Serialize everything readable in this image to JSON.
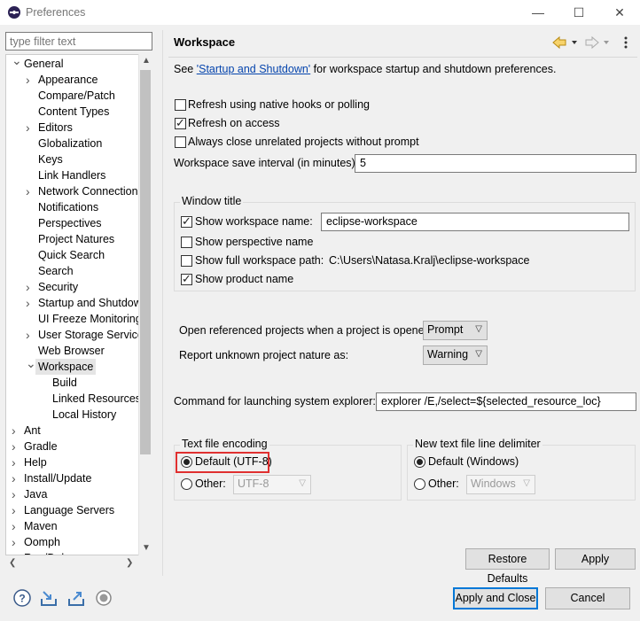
{
  "window": {
    "title": "Preferences",
    "controls": [
      "—",
      "☐",
      "✕"
    ]
  },
  "filter": {
    "placeholder": "type filter text"
  },
  "tree": [
    {
      "label": "General",
      "level": 0,
      "expander": "open"
    },
    {
      "label": "Appearance",
      "level": 1,
      "expander": "closed"
    },
    {
      "label": "Compare/Patch",
      "level": 1,
      "expander": ""
    },
    {
      "label": "Content Types",
      "level": 1,
      "expander": ""
    },
    {
      "label": "Editors",
      "level": 1,
      "expander": "closed"
    },
    {
      "label": "Globalization",
      "level": 1,
      "expander": ""
    },
    {
      "label": "Keys",
      "level": 1,
      "expander": ""
    },
    {
      "label": "Link Handlers",
      "level": 1,
      "expander": ""
    },
    {
      "label": "Network Connections",
      "level": 1,
      "expander": "closed"
    },
    {
      "label": "Notifications",
      "level": 1,
      "expander": ""
    },
    {
      "label": "Perspectives",
      "level": 1,
      "expander": ""
    },
    {
      "label": "Project Natures",
      "level": 1,
      "expander": ""
    },
    {
      "label": "Quick Search",
      "level": 1,
      "expander": ""
    },
    {
      "label": "Search",
      "level": 1,
      "expander": ""
    },
    {
      "label": "Security",
      "level": 1,
      "expander": "closed"
    },
    {
      "label": "Startup and Shutdown",
      "level": 1,
      "expander": "closed"
    },
    {
      "label": "UI Freeze Monitoring",
      "level": 1,
      "expander": ""
    },
    {
      "label": "User Storage Service",
      "level": 1,
      "expander": "closed"
    },
    {
      "label": "Web Browser",
      "level": 1,
      "expander": ""
    },
    {
      "label": "Workspace",
      "level": 1,
      "expander": "open",
      "selected": true
    },
    {
      "label": "Build",
      "level": 2,
      "expander": ""
    },
    {
      "label": "Linked Resources",
      "level": 2,
      "expander": ""
    },
    {
      "label": "Local History",
      "level": 2,
      "expander": ""
    },
    {
      "label": "Ant",
      "level": 0,
      "expander": "closed"
    },
    {
      "label": "Gradle",
      "level": 0,
      "expander": "closed"
    },
    {
      "label": "Help",
      "level": 0,
      "expander": "closed"
    },
    {
      "label": "Install/Update",
      "level": 0,
      "expander": "closed"
    },
    {
      "label": "Java",
      "level": 0,
      "expander": "closed"
    },
    {
      "label": "Language Servers",
      "level": 0,
      "expander": "closed"
    },
    {
      "label": "Maven",
      "level": 0,
      "expander": "closed"
    },
    {
      "label": "Oomph",
      "level": 0,
      "expander": "closed"
    },
    {
      "label": "Run/Debug",
      "level": 0,
      "expander": "closed"
    }
  ],
  "page": {
    "title": "Workspace",
    "intro_prefix": "See ",
    "intro_link": "'Startup and Shutdown'",
    "intro_suffix": " for workspace startup and shutdown preferences.",
    "options": [
      {
        "label": "Refresh using native hooks or polling",
        "checked": false
      },
      {
        "label": "Refresh on access",
        "checked": true
      },
      {
        "label": "Always close unrelated projects without prompt",
        "checked": false
      }
    ],
    "save_interval_label": "Workspace save interval (in minutes):",
    "save_interval_value": "5",
    "window_title": {
      "group_label": "Window title",
      "show_workspace_name_label": "Show workspace name:",
      "show_workspace_name_checked": true,
      "workspace_name_value": "eclipse-workspace",
      "show_perspective_name_label": "Show perspective name",
      "show_perspective_name_checked": false,
      "show_full_path_label": "Show full workspace path:",
      "show_full_path_checked": false,
      "full_path_value": "C:\\Users\\Natasa.Kralj\\eclipse-workspace",
      "show_product_name_label": "Show product name",
      "show_product_name_checked": true
    },
    "open_referenced_label": "Open referenced projects when a project is opened:",
    "open_referenced_value": "Prompt",
    "unknown_nature_label": "Report unknown project nature as:",
    "unknown_nature_value": "Warning",
    "explorer_label": "Command for launching system explorer:",
    "explorer_value": "explorer /E,/select=${selected_resource_loc}",
    "encoding": {
      "group_label": "Text file encoding",
      "default_label": "Default (UTF-8)",
      "default_checked": true,
      "other_label": "Other:",
      "other_value": "UTF-8"
    },
    "line_delimiter": {
      "group_label": "New text file line delimiter",
      "default_label": "Default (Windows)",
      "default_checked": true,
      "other_label": "Other:",
      "other_value": "Windows"
    },
    "restore_defaults_label": "Restore Defaults",
    "apply_label": "Apply"
  },
  "footer": {
    "apply_close_label": "Apply and Close",
    "cancel_label": "Cancel",
    "icons": [
      "help-icon",
      "import-icon",
      "export-icon",
      "record-icon"
    ]
  },
  "colors": {
    "highlight_box": "#e03030",
    "link": "#0645ad",
    "default_button_border": "#0078d7"
  }
}
